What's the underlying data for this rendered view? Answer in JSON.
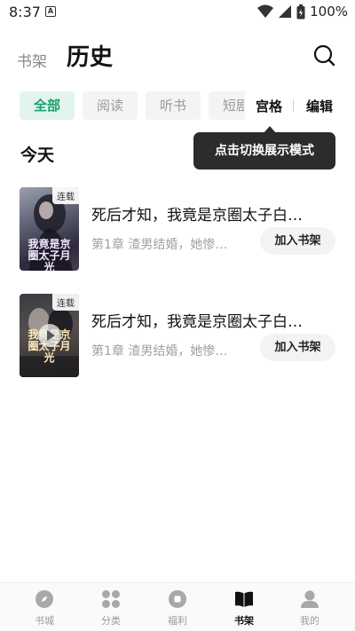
{
  "status_bar": {
    "time": "8:37",
    "badge": "A",
    "battery": "100%"
  },
  "header": {
    "tab_bookshelf": "书架",
    "tab_history": "历史"
  },
  "filters": {
    "all": "全部",
    "read": "阅读",
    "listen": "听书",
    "short_partial": "短剧"
  },
  "view_switch": {
    "grid": "宫格",
    "edit": "编辑"
  },
  "tooltip": "点击切换展示模式",
  "section": {
    "title": "今天"
  },
  "books": [
    {
      "title": "死后才知，我竟是京圈太子白…",
      "subtitle": "第1章 渣男结婚，她惨…",
      "badge": "连载",
      "cover_text": "我竟是京圈太子月光",
      "add_label": "加入书架"
    },
    {
      "title": "死后才知，我竟是京圈太子白…",
      "subtitle": "第1章 渣男结婚，她惨…",
      "badge": "连载",
      "cover_text": "我竟是京圈太子月光",
      "add_label": "加入书架"
    }
  ],
  "bottom_nav": [
    {
      "label": "书城",
      "icon": "compass-icon",
      "active": false
    },
    {
      "label": "分类",
      "icon": "category-icon",
      "active": false
    },
    {
      "label": "福利",
      "icon": "gift-icon",
      "active": false
    },
    {
      "label": "书架",
      "icon": "book-icon",
      "active": true
    },
    {
      "label": "我的",
      "icon": "profile-icon",
      "active": false
    }
  ],
  "colors": {
    "accent": "#19a06c",
    "accent_bg": "#e3f4ee",
    "tooltip_bg": "#2c2c2c"
  }
}
